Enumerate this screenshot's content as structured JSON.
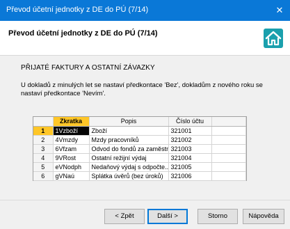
{
  "window": {
    "title": "Převod účetní jednotky z DE do PÚ (7/14)",
    "close_glyph": "✕"
  },
  "header": {
    "title": "Převod účetní jednotky z DE do PÚ (7/14)"
  },
  "section": {
    "title": "PŘIJATÉ FAKTURY A OSTATNÍ ZÁVAZKY",
    "description": "U dokladů z minulých let se nastaví předkontace 'Bez', dokladům z nového roku se nastaví předkontace 'Nevím'."
  },
  "grid": {
    "headers": [
      "",
      "Zkratka",
      "Popis",
      "Číslo účtu"
    ],
    "rows": [
      {
        "n": "1",
        "code": "1Vzboží",
        "desc": "Zboží",
        "acct": "321001"
      },
      {
        "n": "2",
        "code": "4Vmzdy",
        "desc": "Mzdy pracovníků",
        "acct": "321002"
      },
      {
        "n": "3",
        "code": "6Vfzam",
        "desc": "Odvod do fondů za zaměstn...",
        "acct": "321003"
      },
      {
        "n": "4",
        "code": "9VRost",
        "desc": "Ostatní režijní výdaj",
        "acct": "321004"
      },
      {
        "n": "5",
        "code": "eVNodph",
        "desc": "Nedaňový výdaj s odpočte...",
        "acct": "321005"
      },
      {
        "n": "6",
        "code": "gVNaú",
        "desc": "Splátka úvěrů (bez úroků)",
        "acct": "321006"
      }
    ]
  },
  "buttons": {
    "back": "< Zpět",
    "next": "Další >",
    "cancel": "Storno",
    "help": "Nápověda"
  }
}
